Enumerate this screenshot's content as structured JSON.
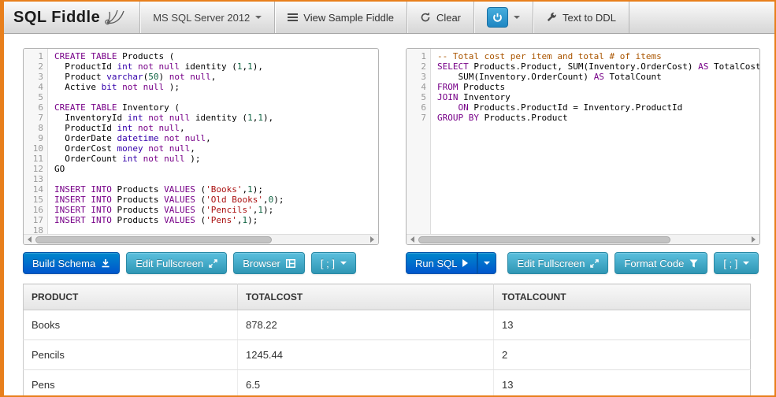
{
  "colors": {
    "primary_blue": "#0066cc",
    "info_teal": "#49afcd",
    "frame_orange": "#e87f1c"
  },
  "header": {
    "title": "SQL Fiddle",
    "db_select": {
      "label": "MS SQL Server 2012",
      "icon": "chevron-down-icon"
    },
    "view_sample": {
      "label": "View Sample Fiddle",
      "icon": "sample-list-icon"
    },
    "clear": {
      "label": "Clear",
      "icon": "refresh-icon"
    },
    "power": {
      "icon": "power-icon"
    },
    "text_to_ddl": {
      "label": "Text to DDL",
      "icon": "wrench-icon"
    }
  },
  "editors": {
    "left": {
      "lines": [
        [
          [
            "k",
            "CREATE TABLE"
          ],
          [
            "p",
            " Products ("
          ]
        ],
        [
          [
            "p",
            "  ProductId "
          ],
          [
            "t",
            "int"
          ],
          [
            "p",
            " "
          ],
          [
            "k",
            "not null"
          ],
          [
            "p",
            " identity ("
          ],
          [
            "n",
            "1"
          ],
          [
            "p",
            ","
          ],
          [
            "n",
            "1"
          ],
          [
            "p",
            "),"
          ]
        ],
        [
          [
            "p",
            "  Product "
          ],
          [
            "t",
            "varchar"
          ],
          [
            "p",
            "("
          ],
          [
            "n",
            "50"
          ],
          [
            "p",
            ") "
          ],
          [
            "k",
            "not null"
          ],
          [
            "p",
            ","
          ]
        ],
        [
          [
            "p",
            "  Active "
          ],
          [
            "t",
            "bit"
          ],
          [
            "p",
            " "
          ],
          [
            "k",
            "not null"
          ],
          [
            "p",
            " );"
          ]
        ],
        [],
        [
          [
            "k",
            "CREATE TABLE"
          ],
          [
            "p",
            " Inventory ("
          ]
        ],
        [
          [
            "p",
            "  InventoryId "
          ],
          [
            "t",
            "int"
          ],
          [
            "p",
            " "
          ],
          [
            "k",
            "not null"
          ],
          [
            "p",
            " identity ("
          ],
          [
            "n",
            "1"
          ],
          [
            "p",
            ","
          ],
          [
            "n",
            "1"
          ],
          [
            "p",
            "),"
          ]
        ],
        [
          [
            "p",
            "  ProductId "
          ],
          [
            "t",
            "int"
          ],
          [
            "p",
            " "
          ],
          [
            "k",
            "not null"
          ],
          [
            "p",
            ","
          ]
        ],
        [
          [
            "p",
            "  OrderDate "
          ],
          [
            "t",
            "datetime"
          ],
          [
            "p",
            " "
          ],
          [
            "k",
            "not null"
          ],
          [
            "p",
            ","
          ]
        ],
        [
          [
            "p",
            "  OrderCost "
          ],
          [
            "t",
            "money"
          ],
          [
            "p",
            " "
          ],
          [
            "k",
            "not null"
          ],
          [
            "p",
            ","
          ]
        ],
        [
          [
            "p",
            "  OrderCount "
          ],
          [
            "t",
            "int"
          ],
          [
            "p",
            " "
          ],
          [
            "k",
            "not null"
          ],
          [
            "p",
            " );"
          ]
        ],
        [
          [
            "p",
            "GO"
          ]
        ],
        [],
        [
          [
            "k",
            "INSERT INTO"
          ],
          [
            "p",
            " Products "
          ],
          [
            "k",
            "VALUES"
          ],
          [
            "p",
            " ("
          ],
          [
            "s",
            "'Books'"
          ],
          [
            "p",
            ","
          ],
          [
            "n",
            "1"
          ],
          [
            "p",
            ");"
          ]
        ],
        [
          [
            "k",
            "INSERT INTO"
          ],
          [
            "p",
            " Products "
          ],
          [
            "k",
            "VALUES"
          ],
          [
            "p",
            " ("
          ],
          [
            "s",
            "'Old Books'"
          ],
          [
            "p",
            ","
          ],
          [
            "n",
            "0"
          ],
          [
            "p",
            ");"
          ]
        ],
        [
          [
            "k",
            "INSERT INTO"
          ],
          [
            "p",
            " Products "
          ],
          [
            "k",
            "VALUES"
          ],
          [
            "p",
            " ("
          ],
          [
            "s",
            "'Pencils'"
          ],
          [
            "p",
            ","
          ],
          [
            "n",
            "1"
          ],
          [
            "p",
            ");"
          ]
        ],
        [
          [
            "k",
            "INSERT INTO"
          ],
          [
            "p",
            " Products "
          ],
          [
            "k",
            "VALUES"
          ],
          [
            "p",
            " ("
          ],
          [
            "s",
            "'Pens'"
          ],
          [
            "p",
            ","
          ],
          [
            "n",
            "1"
          ],
          [
            "p",
            ");"
          ]
        ],
        []
      ]
    },
    "right": {
      "lines": [
        [
          [
            "c",
            "-- Total cost per item and total # of items"
          ]
        ],
        [
          [
            "k",
            "SELECT"
          ],
          [
            "p",
            " Products.Product, SUM(Inventory.OrderCost) "
          ],
          [
            "k",
            "AS"
          ],
          [
            "p",
            " TotalCost,"
          ]
        ],
        [
          [
            "p",
            "    SUM(Inventory.OrderCount) "
          ],
          [
            "k",
            "AS"
          ],
          [
            "p",
            " TotalCount"
          ]
        ],
        [
          [
            "k",
            "FROM"
          ],
          [
            "p",
            " Products"
          ]
        ],
        [
          [
            "k",
            "JOIN"
          ],
          [
            "p",
            " Inventory"
          ]
        ],
        [
          [
            "p",
            "    "
          ],
          [
            "k",
            "ON"
          ],
          [
            "p",
            " Products.ProductId = Inventory.ProductId"
          ]
        ],
        [
          [
            "k",
            "GROUP BY"
          ],
          [
            "p",
            " Products.Product"
          ]
        ]
      ]
    }
  },
  "buttons": {
    "build_schema": "Build Schema",
    "edit_fullscreen_left": "Edit Fullscreen",
    "browser": "Browser",
    "terminator_left": "[ ; ]",
    "run_sql": "Run SQL",
    "edit_fullscreen_right": "Edit Fullscreen",
    "format_code": "Format Code",
    "terminator_right": "[ ; ]"
  },
  "results": {
    "headers": [
      "PRODUCT",
      "TOTALCOST",
      "TOTALCOUNT"
    ],
    "rows": [
      [
        "Books",
        "878.22",
        "13"
      ],
      [
        "Pencils",
        "1245.44",
        "2"
      ],
      [
        "Pens",
        "6.5",
        "13"
      ]
    ]
  }
}
